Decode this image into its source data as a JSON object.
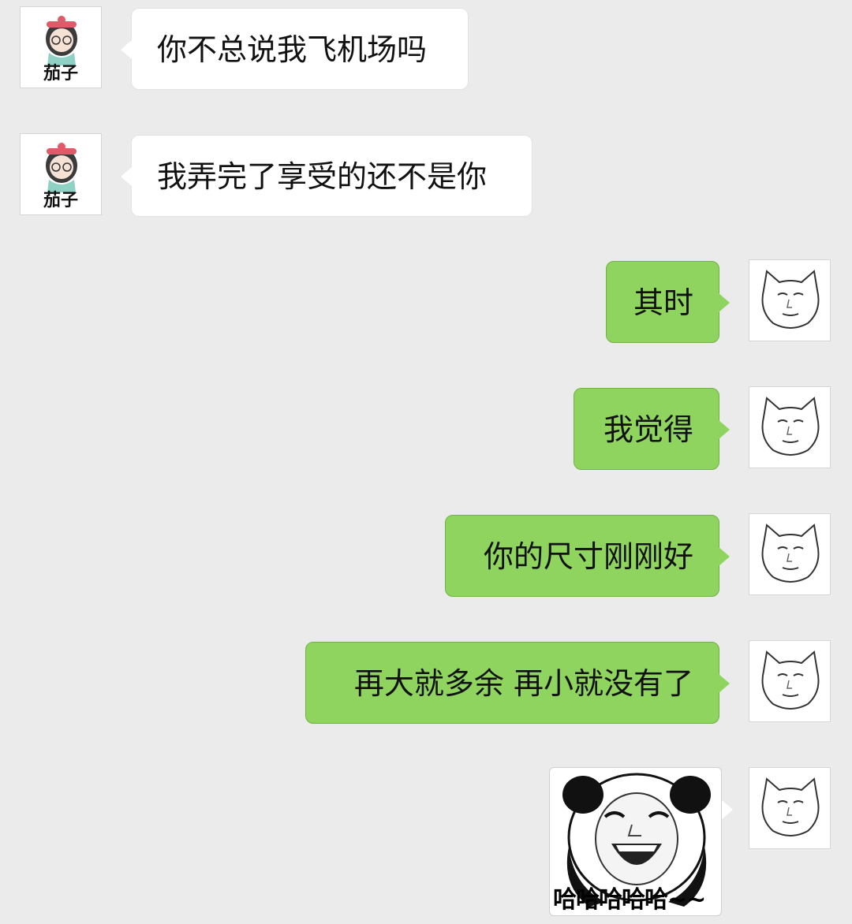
{
  "contact": {
    "name": "茄子"
  },
  "messages": [
    {
      "side": "left",
      "text": "你不总说我飞机场吗"
    },
    {
      "side": "left",
      "text": "我弄完了享受的还不是你"
    },
    {
      "side": "right",
      "text": "其时"
    },
    {
      "side": "right",
      "text": "我觉得"
    },
    {
      "side": "right",
      "text": "你的尺寸刚刚好"
    },
    {
      "side": "right",
      "text": "再大就多余 再小就没有了"
    },
    {
      "side": "right",
      "type": "sticker",
      "sticker_icon": "laughing-panda-sticker",
      "caption": "哈哈哈哈哈~~"
    }
  ],
  "colors": {
    "background": "#ebebeb",
    "incoming_bubble": "#ffffff",
    "outgoing_bubble": "#8ed45f"
  }
}
